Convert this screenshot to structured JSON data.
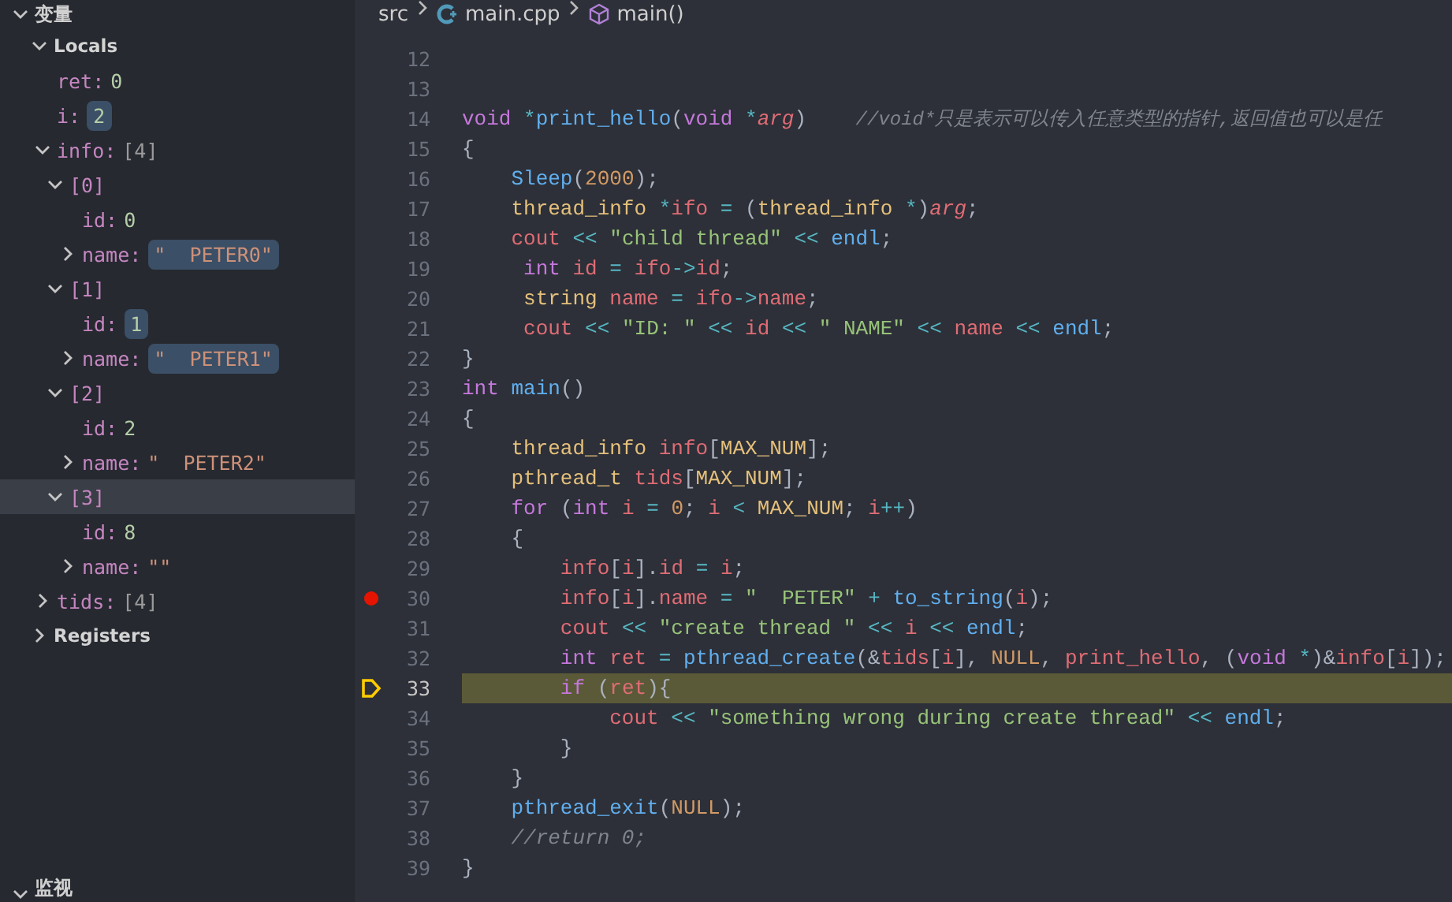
{
  "variables": {
    "title": "变量",
    "expanded": true,
    "groups": [
      {
        "label": "Locals",
        "expanded": true,
        "children": [
          {
            "name": "ret:",
            "value": "0",
            "kind": "number",
            "changed": false,
            "selected": false
          },
          {
            "name": "i:",
            "value": "2",
            "kind": "number",
            "changed": true,
            "selected": false
          },
          {
            "name": "info:",
            "value": "[4]",
            "kind": "array",
            "expanded": true,
            "changed": false,
            "selected": false,
            "children": [
              {
                "name": "[0]",
                "expanded": true,
                "changed": false,
                "selected": false,
                "children": [
                  {
                    "name": "id:",
                    "value": "0",
                    "kind": "number",
                    "changed": false,
                    "selected": false
                  },
                  {
                    "name": "name:",
                    "value": "\"  PETER0\"",
                    "kind": "string",
                    "expanded": false,
                    "changed": true,
                    "selected": false
                  }
                ]
              },
              {
                "name": "[1]",
                "expanded": true,
                "changed": false,
                "selected": false,
                "children": [
                  {
                    "name": "id:",
                    "value": "1",
                    "kind": "number",
                    "changed": true,
                    "selected": false
                  },
                  {
                    "name": "name:",
                    "value": "\"  PETER1\"",
                    "kind": "string",
                    "expanded": false,
                    "changed": true,
                    "selected": false
                  }
                ]
              },
              {
                "name": "[2]",
                "expanded": true,
                "changed": false,
                "selected": false,
                "children": [
                  {
                    "name": "id:",
                    "value": "2",
                    "kind": "number",
                    "changed": false,
                    "selected": false
                  },
                  {
                    "name": "name:",
                    "value": "\"  PETER2\"",
                    "kind": "string",
                    "expanded": false,
                    "changed": false,
                    "selected": false
                  }
                ]
              },
              {
                "name": "[3]",
                "expanded": true,
                "changed": false,
                "selected": true,
                "children": [
                  {
                    "name": "id:",
                    "value": "8",
                    "kind": "number",
                    "changed": false,
                    "selected": false
                  },
                  {
                    "name": "name:",
                    "value": "\"\"",
                    "kind": "string",
                    "expanded": false,
                    "changed": false,
                    "selected": false
                  }
                ]
              }
            ]
          },
          {
            "name": "tids:",
            "value": "[4]",
            "kind": "array",
            "expanded": false,
            "changed": false,
            "selected": false
          }
        ]
      },
      {
        "label": "Registers",
        "expanded": false
      }
    ]
  },
  "watch": {
    "title": "监视",
    "expanded": true
  },
  "breadcrumb": [
    {
      "kind": "folder",
      "label": "src"
    },
    {
      "kind": "file",
      "label": "main.cpp"
    },
    {
      "kind": "function",
      "label": "main()"
    }
  ],
  "editor": {
    "lines": [
      {
        "number": "12",
        "breakpoint": false,
        "current": false
      },
      {
        "number": "13",
        "breakpoint": false,
        "current": false
      },
      {
        "number": "14",
        "code": "void *print_hello(void *arg)    //void*只是表示可以传入任意类型的指针,返回值也可以是任",
        "breakpoint": false,
        "current": false
      },
      {
        "number": "15",
        "code": "{",
        "breakpoint": false,
        "current": false
      },
      {
        "number": "16",
        "code": "    Sleep(2000);",
        "breakpoint": false,
        "current": false
      },
      {
        "number": "17",
        "code": "    thread_info *ifo = (thread_info *)arg;",
        "breakpoint": false,
        "current": false
      },
      {
        "number": "18",
        "code": "    cout << \"child thread\" << endl;",
        "breakpoint": false,
        "current": false
      },
      {
        "number": "19",
        "code": "     int id = ifo->id;",
        "breakpoint": false,
        "current": false
      },
      {
        "number": "20",
        "code": "     string name = ifo->name;",
        "breakpoint": false,
        "current": false
      },
      {
        "number": "21",
        "code": "     cout << \"ID: \" << id << \" NAME\" << name << endl;",
        "breakpoint": false,
        "current": false
      },
      {
        "number": "22",
        "code": "}",
        "breakpoint": false,
        "current": false
      },
      {
        "number": "23",
        "code": "int main()",
        "breakpoint": false,
        "current": false
      },
      {
        "number": "24",
        "code": "{",
        "breakpoint": false,
        "current": false
      },
      {
        "number": "25",
        "code": "    thread_info info[MAX_NUM];",
        "breakpoint": false,
        "current": false
      },
      {
        "number": "26",
        "code": "    pthread_t tids[MAX_NUM];",
        "breakpoint": false,
        "current": false
      },
      {
        "number": "27",
        "code": "    for (int i = 0; i < MAX_NUM; i++)",
        "breakpoint": false,
        "current": false
      },
      {
        "number": "28",
        "code": "    {",
        "breakpoint": false,
        "current": false
      },
      {
        "number": "29",
        "code": "        info[i].id = i;",
        "breakpoint": false,
        "current": false
      },
      {
        "number": "30",
        "code": "        info[i].name = \"  PETER\" + to_string(i);",
        "breakpoint": true,
        "current": false
      },
      {
        "number": "31",
        "code": "        cout << \"create thread \" << i << endl;",
        "breakpoint": false,
        "current": false
      },
      {
        "number": "32",
        "code": "        int ret = pthread_create(&tids[i], NULL, print_hello, (void *)&info[i]);",
        "breakpoint": false,
        "current": false
      },
      {
        "number": "33",
        "code": "        if (ret){",
        "breakpoint": false,
        "current": true
      },
      {
        "number": "34",
        "code": "            cout << \"something wrong during create thread\" << endl;",
        "breakpoint": false,
        "current": false
      },
      {
        "number": "35",
        "code": "        }",
        "breakpoint": false,
        "current": false
      },
      {
        "number": "36",
        "code": "    }",
        "breakpoint": false,
        "current": false
      },
      {
        "number": "37",
        "code": "    pthread_exit(NULL);",
        "breakpoint": false,
        "current": false
      },
      {
        "number": "38",
        "code": "    //return 0;",
        "breakpoint": false,
        "current": false
      },
      {
        "number": "39",
        "code": "}",
        "breakpoint": false,
        "current": false
      }
    ]
  }
}
